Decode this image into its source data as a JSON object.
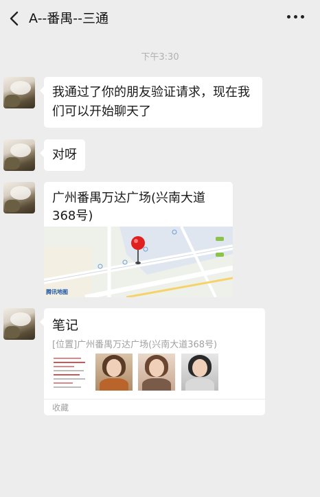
{
  "header": {
    "title": "A--番禺--三通",
    "back_icon": "chevron-left-icon",
    "more_icon": "ellipsis-icon"
  },
  "chat": {
    "timestamp": "下午3:30",
    "messages": [
      {
        "type": "text",
        "text": "我通过了你的朋友验证请求，现在我们可以开始聊天了"
      },
      {
        "type": "text",
        "text": "对呀"
      },
      {
        "type": "location",
        "title": "广州番禺万达广场(兴南大道368号)",
        "map_provider": "腾讯地图"
      },
      {
        "type": "note",
        "title": "笔记",
        "subtitle": "[位置]广州番禺万达广场(兴南大道368号)",
        "footer": "收藏"
      }
    ]
  },
  "colors": {
    "background": "#ededed",
    "bubble": "#ffffff",
    "pin": "#e02020",
    "muted_text": "#a0a0a0"
  }
}
